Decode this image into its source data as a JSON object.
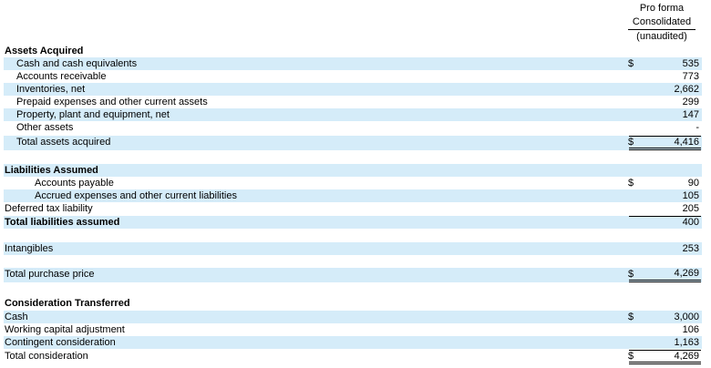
{
  "header": {
    "line1": "Pro forma",
    "line2": "Consolidated",
    "line3": "(unaudited)"
  },
  "sections": {
    "assets_title": "Assets Acquired",
    "liabilities_title": "Liabilities Assumed",
    "consideration_title": "Consideration Transferred"
  },
  "rows": {
    "cash_equivalents": {
      "label": "Cash and cash equivalents",
      "currency": "$",
      "value": "535"
    },
    "accounts_receivable": {
      "label": "Accounts receivable",
      "value": "773"
    },
    "inventories": {
      "label": "Inventories, net",
      "value": "2,662"
    },
    "prepaid": {
      "label": "Prepaid expenses and other current assets",
      "value": "299"
    },
    "ppe": {
      "label": "Property, plant and equipment, net",
      "value": "147"
    },
    "other_assets": {
      "label": "Other assets",
      "value": "-"
    },
    "total_assets": {
      "label": "Total assets acquired",
      "currency": "$",
      "value": "4,416"
    },
    "accounts_payable": {
      "label": "Accounts payable",
      "currency": "$",
      "value": "90"
    },
    "accrued": {
      "label": "Accrued expenses and other current liabilities",
      "value": "105"
    },
    "deferred_tax": {
      "label": "Deferred tax liability",
      "value": "205"
    },
    "total_liabilities": {
      "label": "Total liabilities assumed",
      "value": "400"
    },
    "intangibles": {
      "label": "Intangibles",
      "value": "253"
    },
    "total_purchase": {
      "label": "Total purchase price",
      "currency": "$",
      "value": "4,269"
    },
    "cash": {
      "label": "Cash",
      "currency": "$",
      "value": "3,000"
    },
    "working_capital": {
      "label": "Working capital adjustment",
      "value": "106"
    },
    "contingent": {
      "label": "Contingent consideration",
      "value": "1,163"
    },
    "total_consideration": {
      "label": "Total consideration",
      "currency": "$",
      "value": "4,269"
    }
  }
}
